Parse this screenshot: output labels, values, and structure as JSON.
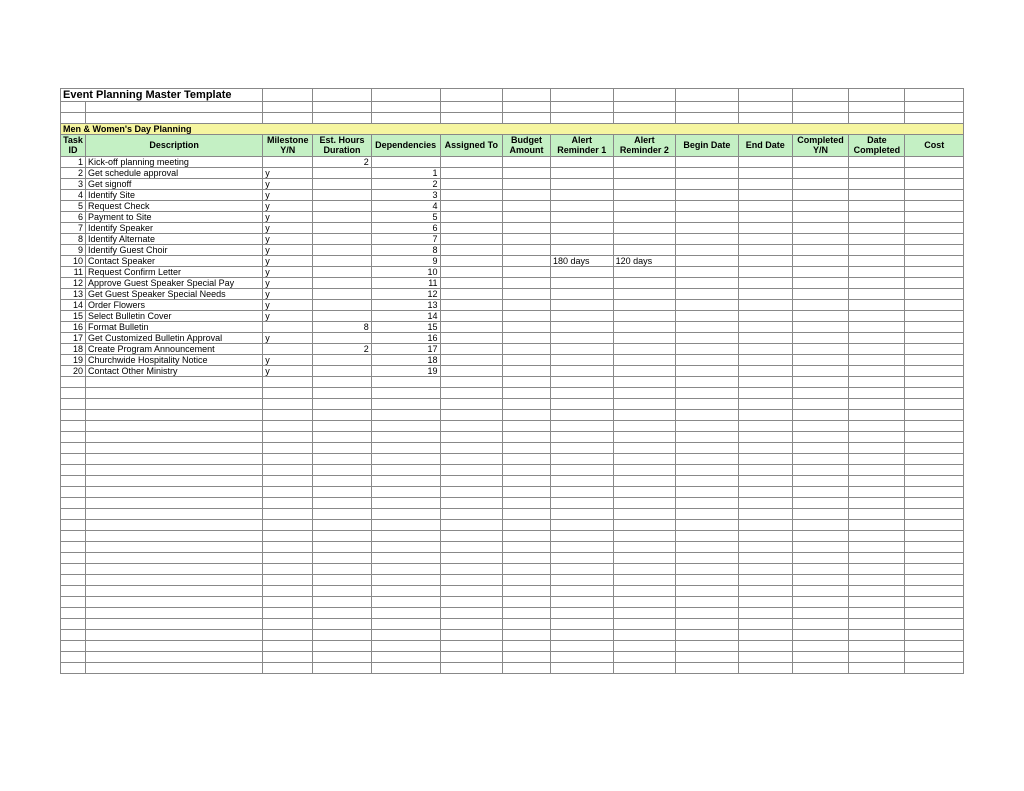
{
  "title": "Event Planning  Master Template",
  "section": "Men & Women's Day Planning",
  "headers": {
    "id": "Task ID",
    "desc": "Description",
    "ms": "Milestone Y/N",
    "est": "Est. Hours Duration",
    "dep": "Dependencies",
    "asg": "Assigned To",
    "bud": "Budget Amount",
    "al1": "Alert Reminder 1",
    "al2": "Alert Reminder 2",
    "beg": "Begin Date",
    "end": "End Date",
    "cmp": "Completed Y/N",
    "dc": "Date Completed",
    "cost": "Cost"
  },
  "rows": [
    {
      "id": "1",
      "desc": "Kick-off planning meeting",
      "ms": "",
      "est": "2",
      "dep": "",
      "al1": "",
      "al2": ""
    },
    {
      "id": "2",
      "desc": "Get schedule approval",
      "ms": "y",
      "est": "",
      "dep": "1",
      "al1": "",
      "al2": ""
    },
    {
      "id": "3",
      "desc": "Get signoff",
      "ms": "y",
      "est": "",
      "dep": "2",
      "al1": "",
      "al2": ""
    },
    {
      "id": "4",
      "desc": "Identify Site",
      "ms": "y",
      "est": "",
      "dep": "3",
      "al1": "",
      "al2": ""
    },
    {
      "id": "5",
      "desc": "Request Check",
      "ms": "y",
      "est": "",
      "dep": "4",
      "al1": "",
      "al2": ""
    },
    {
      "id": "6",
      "desc": "Payment to Site",
      "ms": "y",
      "est": "",
      "dep": "5",
      "al1": "",
      "al2": ""
    },
    {
      "id": "7",
      "desc": "Identify Speaker",
      "ms": "y",
      "est": "",
      "dep": "6",
      "al1": "",
      "al2": ""
    },
    {
      "id": "8",
      "desc": "Identify Alternate",
      "ms": "y",
      "est": "",
      "dep": "7",
      "al1": "",
      "al2": ""
    },
    {
      "id": "9",
      "desc": "Identify Guest Choir",
      "ms": "y",
      "est": "",
      "dep": "8",
      "al1": "",
      "al2": ""
    },
    {
      "id": "10",
      "desc": "Contact Speaker",
      "ms": "y",
      "est": "",
      "dep": "9",
      "al1": "180 days",
      "al2": "120 days"
    },
    {
      "id": "11",
      "desc": "Request Confirm Letter",
      "ms": "y",
      "est": "",
      "dep": "10",
      "al1": "",
      "al2": ""
    },
    {
      "id": "12",
      "desc": "Approve Guest Speaker Special Pay",
      "ms": "y",
      "est": "",
      "dep": "11",
      "al1": "",
      "al2": ""
    },
    {
      "id": "13",
      "desc": "Get Guest Speaker Special Needs",
      "ms": "y",
      "est": "",
      "dep": "12",
      "al1": "",
      "al2": ""
    },
    {
      "id": "14",
      "desc": "Order Flowers",
      "ms": "y",
      "est": "",
      "dep": "13",
      "al1": "",
      "al2": ""
    },
    {
      "id": "15",
      "desc": "Select Bulletin Cover",
      "ms": "y",
      "est": "",
      "dep": "14",
      "al1": "",
      "al2": ""
    },
    {
      "id": "16",
      "desc": "Format Bulletin",
      "ms": "",
      "est": "8",
      "dep": "15",
      "al1": "",
      "al2": ""
    },
    {
      "id": "17",
      "desc": "Get Customized Bulletin Approval",
      "ms": "y",
      "est": "",
      "dep": "16",
      "al1": "",
      "al2": ""
    },
    {
      "id": "18",
      "desc": "Create Program Announcement",
      "ms": "",
      "est": "2",
      "dep": "17",
      "al1": "",
      "al2": ""
    },
    {
      "id": "19",
      "desc": "Churchwide Hospitality Notice",
      "ms": "y",
      "est": "",
      "dep": "18",
      "al1": "",
      "al2": ""
    },
    {
      "id": "20",
      "desc": "Contact Other Ministry",
      "ms": "y",
      "est": "",
      "dep": "19",
      "al1": "",
      "al2": ""
    }
  ],
  "empty_rows": 27
}
